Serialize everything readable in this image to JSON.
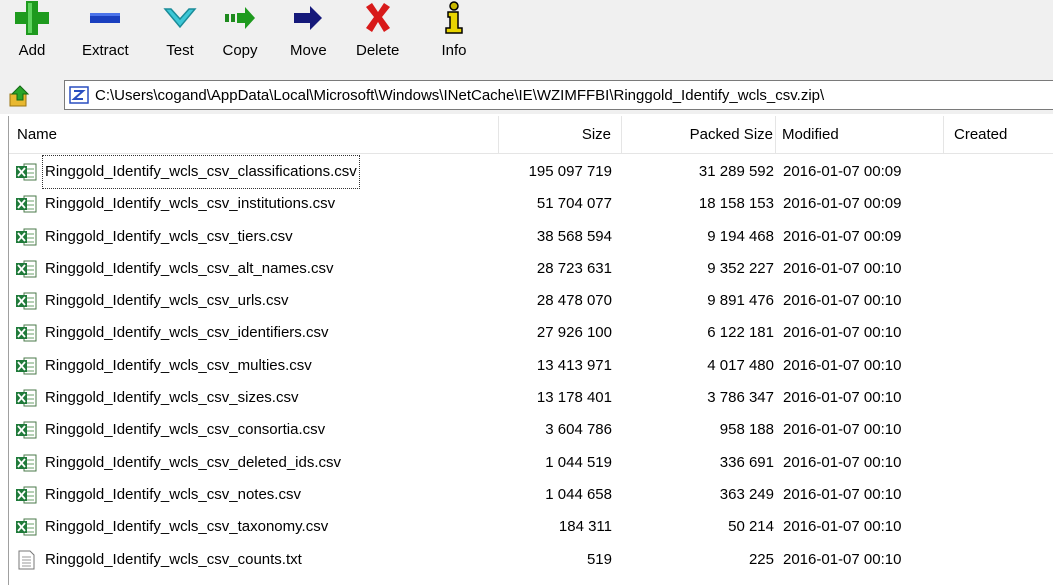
{
  "toolbar": {
    "buttons": [
      {
        "label": "Add",
        "icon": "plus-icon"
      },
      {
        "label": "Extract",
        "icon": "minus-icon"
      },
      {
        "label": "Test",
        "icon": "check-icon"
      },
      {
        "label": "Copy",
        "icon": "copy-arrow-icon"
      },
      {
        "label": "Move",
        "icon": "move-arrow-icon"
      },
      {
        "label": "Delete",
        "icon": "delete-x-icon"
      },
      {
        "label": "Info",
        "icon": "info-icon"
      }
    ]
  },
  "address": {
    "path": "C:\\Users\\cogand\\AppData\\Local\\Microsoft\\Windows\\INetCache\\IE\\WZIMFFBI\\Ringgold_Identify_wcls_csv.zip\\"
  },
  "columns": {
    "name": "Name",
    "size": "Size",
    "packed": "Packed Size",
    "modified": "Modified",
    "created": "Created"
  },
  "files": [
    {
      "name": "Ringgold_Identify_wcls_csv_classifications.csv",
      "size": "195 097 719",
      "packed": "31 289 592",
      "modified": "2016-01-07 00:09",
      "type": "csv"
    },
    {
      "name": "Ringgold_Identify_wcls_csv_institutions.csv",
      "size": "51 704 077",
      "packed": "18 158 153",
      "modified": "2016-01-07 00:09",
      "type": "csv"
    },
    {
      "name": "Ringgold_Identify_wcls_csv_tiers.csv",
      "size": "38 568 594",
      "packed": "9 194 468",
      "modified": "2016-01-07 00:09",
      "type": "csv"
    },
    {
      "name": "Ringgold_Identify_wcls_csv_alt_names.csv",
      "size": "28 723 631",
      "packed": "9 352 227",
      "modified": "2016-01-07 00:10",
      "type": "csv"
    },
    {
      "name": "Ringgold_Identify_wcls_csv_urls.csv",
      "size": "28 478 070",
      "packed": "9 891 476",
      "modified": "2016-01-07 00:10",
      "type": "csv"
    },
    {
      "name": "Ringgold_Identify_wcls_csv_identifiers.csv",
      "size": "27 926 100",
      "packed": "6 122 181",
      "modified": "2016-01-07 00:10",
      "type": "csv"
    },
    {
      "name": "Ringgold_Identify_wcls_csv_multies.csv",
      "size": "13 413 971",
      "packed": "4 017 480",
      "modified": "2016-01-07 00:10",
      "type": "csv"
    },
    {
      "name": "Ringgold_Identify_wcls_csv_sizes.csv",
      "size": "13 178 401",
      "packed": "3 786 347",
      "modified": "2016-01-07 00:10",
      "type": "csv"
    },
    {
      "name": "Ringgold_Identify_wcls_csv_consortia.csv",
      "size": "3 604 786",
      "packed": "958 188",
      "modified": "2016-01-07 00:10",
      "type": "csv"
    },
    {
      "name": "Ringgold_Identify_wcls_csv_deleted_ids.csv",
      "size": "1 044 519",
      "packed": "336 691",
      "modified": "2016-01-07 00:10",
      "type": "csv"
    },
    {
      "name": "Ringgold_Identify_wcls_csv_notes.csv",
      "size": "1 044 658",
      "packed": "363 249",
      "modified": "2016-01-07 00:10",
      "type": "csv"
    },
    {
      "name": "Ringgold_Identify_wcls_csv_taxonomy.csv",
      "size": "184 311",
      "packed": "50 214",
      "modified": "2016-01-07 00:10",
      "type": "csv"
    },
    {
      "name": "Ringgold_Identify_wcls_csv_counts.txt",
      "size": "519",
      "packed": "225",
      "modified": "2016-01-07 00:10",
      "type": "txt"
    }
  ]
}
